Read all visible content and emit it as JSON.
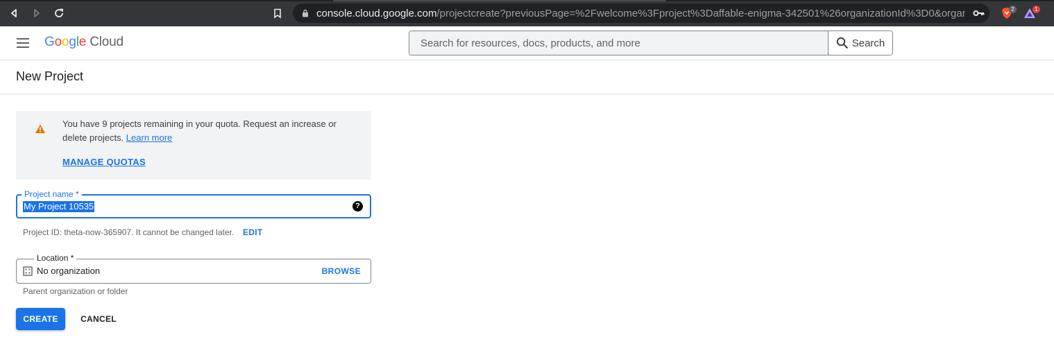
{
  "browser": {
    "url_host": "console.cloud.google.com",
    "url_path": "/projectcreate?previousPage=%2Fwelcome%3Fproject%3Daffable-enigma-342501%26organizationId%3D0&organizationId...",
    "brave_badge": "2",
    "rewards_badge": "1",
    "icons": [
      "back-icon",
      "forward-icon",
      "reload-icon",
      "bookmark-icon",
      "lock-icon",
      "key-icon",
      "brave-shield-icon",
      "brave-rewards-icon"
    ]
  },
  "header": {
    "logo_letters": [
      "G",
      "o",
      "o",
      "g",
      "l",
      "e"
    ],
    "logo_product": "Cloud",
    "search_placeholder": "Search for resources, docs, products, and more",
    "search_button_label": "Search"
  },
  "page": {
    "title": "New Project"
  },
  "quota": {
    "message": "You have 9 projects remaining in your quota. Request an increase or delete projects.",
    "learn_more": "Learn more",
    "manage_quotas": "MANAGE QUOTAS"
  },
  "project_name": {
    "label": "Project name *",
    "value": "My Project 10535",
    "help_icon": "?"
  },
  "project_id": {
    "text": "Project ID: theta-now-365907. It cannot be changed later.",
    "edit_label": "EDIT"
  },
  "location": {
    "label": "Location *",
    "value": "No organization",
    "browse_label": "BROWSE",
    "helper": "Parent organization or folder"
  },
  "actions": {
    "create_label": "CREATE",
    "cancel_label": "CANCEL"
  },
  "colors": {
    "accent": "#1a73e8",
    "chrome_bg": "#35363a",
    "warning": "#e37400"
  }
}
